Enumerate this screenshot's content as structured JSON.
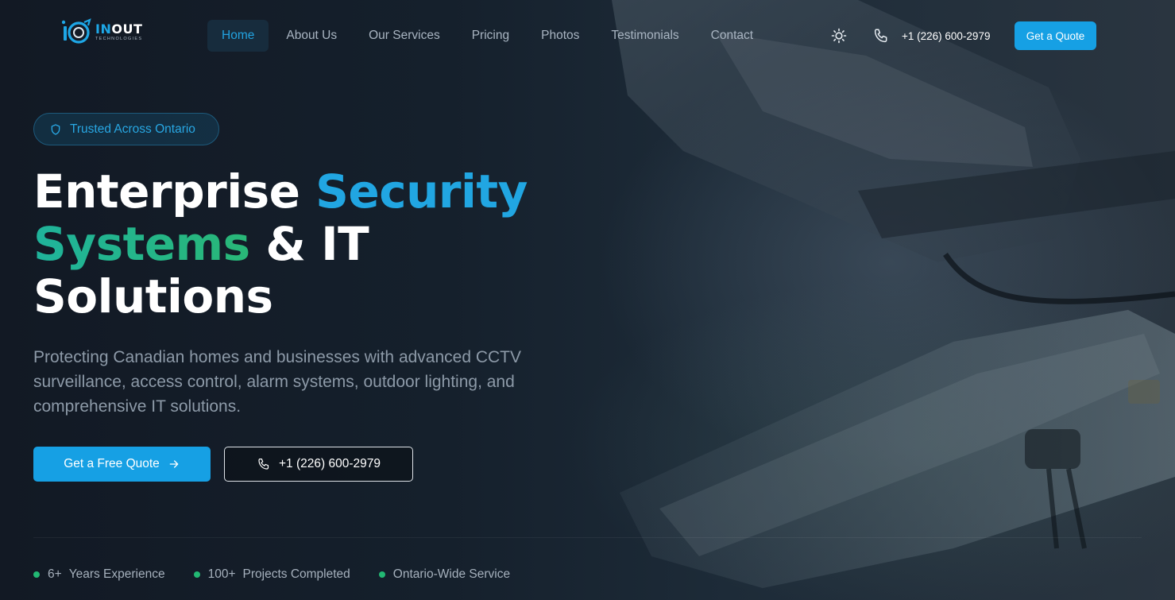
{
  "brand": {
    "name_highlight": "IN",
    "name_rest": "OUT",
    "tagline": "TECHNOLOGIES",
    "accent": "#16a0e4",
    "accent_green": "#22b873"
  },
  "nav": {
    "items": [
      {
        "label": "Home",
        "active": true
      },
      {
        "label": "About Us",
        "active": false
      },
      {
        "label": "Our Services",
        "active": false
      },
      {
        "label": "Pricing",
        "active": false
      },
      {
        "label": "Photos",
        "active": false
      },
      {
        "label": "Testimonials",
        "active": false
      },
      {
        "label": "Contact",
        "active": false
      }
    ]
  },
  "header": {
    "theme_icon": "sun-icon",
    "phone_icon": "phone-icon",
    "phone": "+1 (226) 600-2979",
    "quote_label": "Get a Quote"
  },
  "hero": {
    "badge_icon": "shield-icon",
    "badge": "Trusted Across Ontario",
    "headline": {
      "part1": "Enterprise ",
      "part2": "Security",
      "part3": "Systems",
      "part4": " & IT",
      "part5": "Solutions"
    },
    "subtext": "Protecting Canadian homes and businesses with advanced CCTV surveillance, access control, alarm systems, outdoor lighting, and comprehensive IT solutions.",
    "cta_primary": "Get a Free Quote",
    "cta_primary_icon": "arrow-right-icon",
    "cta_phone": "+1 (226) 600-2979",
    "cta_phone_icon": "phone-icon"
  },
  "stats": [
    {
      "value": "6+",
      "label": "Years Experience"
    },
    {
      "value": "100+",
      "label": "Projects Completed"
    },
    {
      "value": "",
      "label": "Ontario-Wide Service"
    }
  ]
}
